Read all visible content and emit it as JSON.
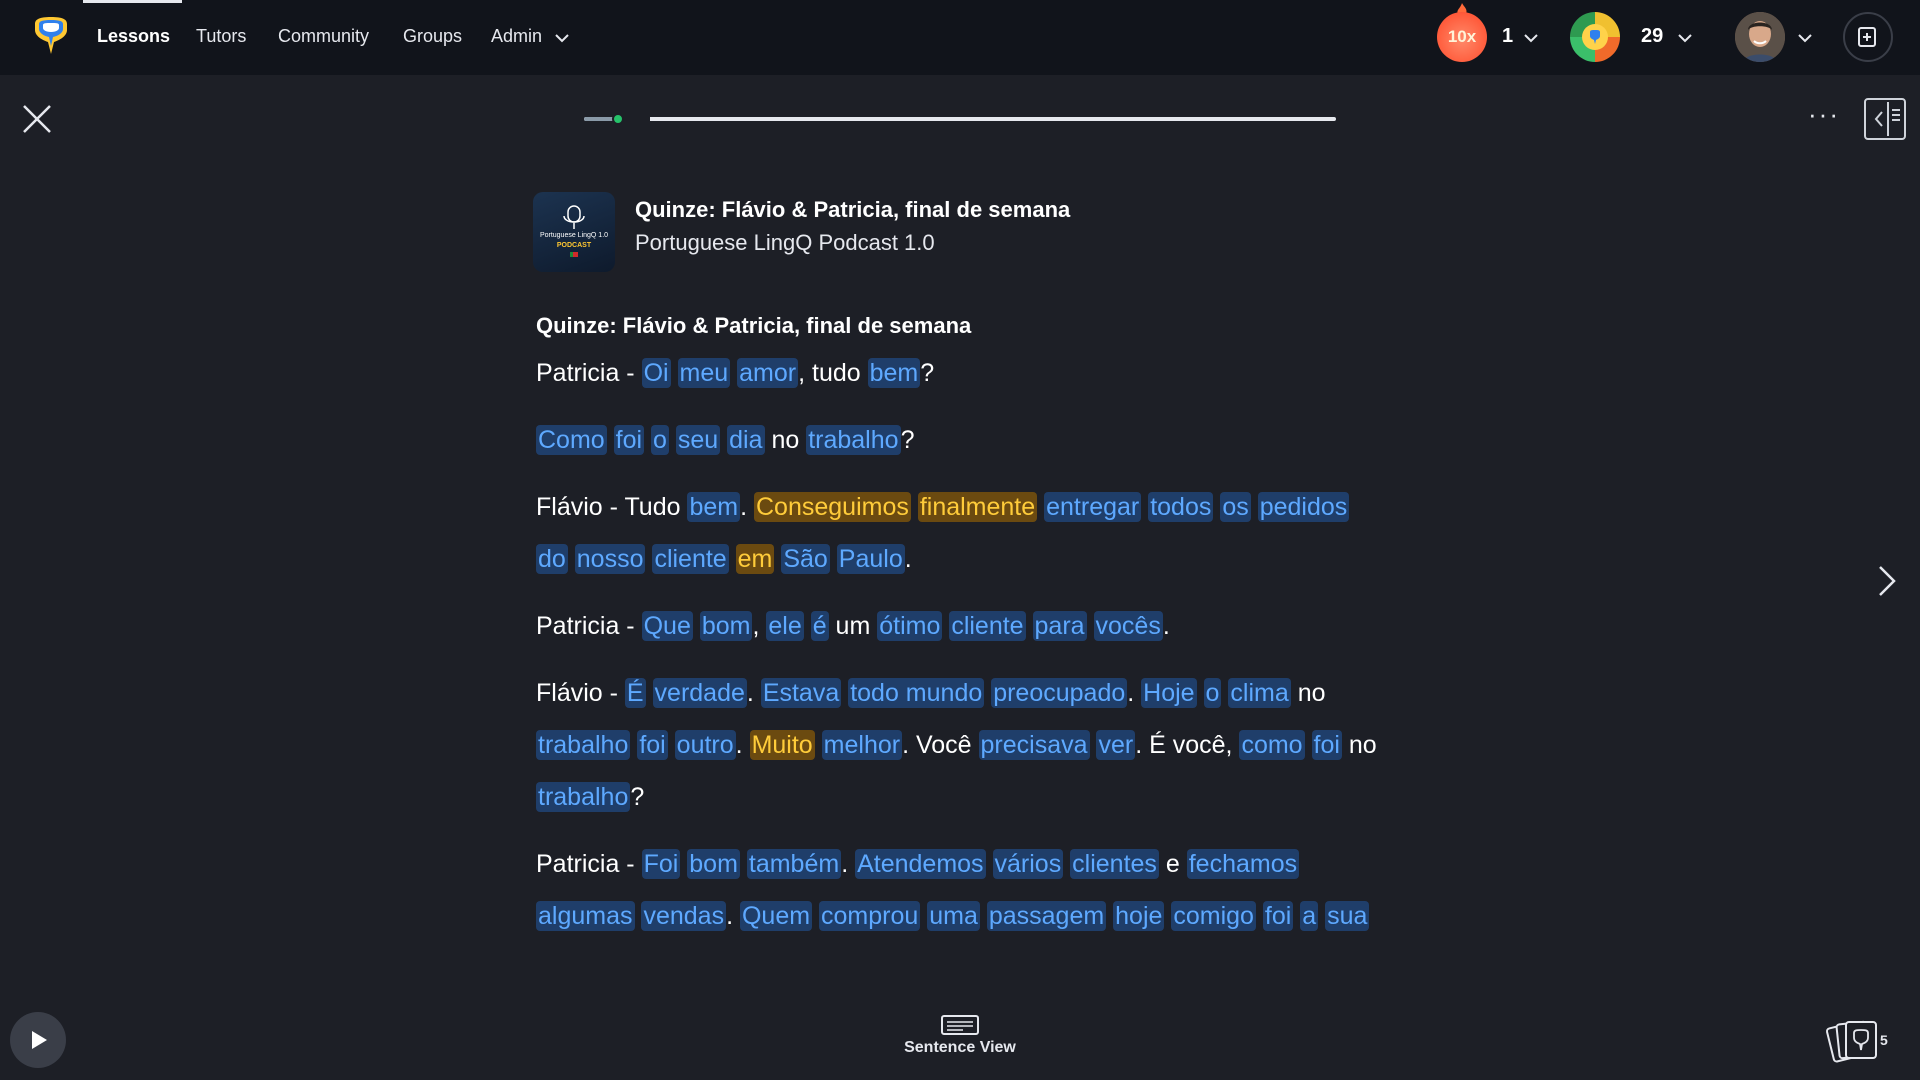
{
  "nav": {
    "items": [
      {
        "label": "Lessons"
      },
      {
        "label": "Tutors"
      },
      {
        "label": "Community"
      },
      {
        "label": "Groups"
      },
      {
        "label": "Admin"
      }
    ],
    "streak_multiplier": "10x",
    "streak_count": "1",
    "coins_count": "29",
    "icons": [
      "logo-icon",
      "chevron-down-icon",
      "flame-icon",
      "coin-icon",
      "avatar",
      "create-lesson-icon"
    ]
  },
  "toolbar": {
    "progress": 0.04,
    "more_label": "···"
  },
  "lesson": {
    "title": "Quinze: Flávio & Patricia, final de semana",
    "course": "Portuguese LingQ Podcast 1.0",
    "thumb_line1": "Portuguese LingQ 1.0",
    "thumb_line2": "PODCAST"
  },
  "reader": {
    "heading": "Quinze: Flávio & Patricia, final de semana",
    "paragraphs": [
      [
        [
          "Patricia - ",
          "p"
        ],
        [
          "Oi",
          "b"
        ],
        [
          " ",
          "p"
        ],
        [
          "meu",
          "b"
        ],
        [
          " ",
          "p"
        ],
        [
          "amor",
          "b"
        ],
        [
          ", tudo ",
          "p"
        ],
        [
          "bem",
          "b"
        ],
        [
          "?",
          "p"
        ]
      ],
      [
        [
          "Como",
          "b"
        ],
        [
          " ",
          "p"
        ],
        [
          "foi",
          "b"
        ],
        [
          " ",
          "p"
        ],
        [
          "o",
          "b"
        ],
        [
          " ",
          "p"
        ],
        [
          "seu",
          "b"
        ],
        [
          " ",
          "p"
        ],
        [
          "dia",
          "b"
        ],
        [
          " no ",
          "p"
        ],
        [
          "trabalho",
          "b"
        ],
        [
          "?",
          "p"
        ]
      ],
      [
        [
          "Flávio - Tudo ",
          "p"
        ],
        [
          "bem",
          "b"
        ],
        [
          ". ",
          "p"
        ],
        [
          "Conseguimos",
          "y"
        ],
        [
          " ",
          "p"
        ],
        [
          "finalmente",
          "y"
        ],
        [
          " ",
          "p"
        ],
        [
          "entregar",
          "b"
        ],
        [
          " ",
          "p"
        ],
        [
          "todos",
          "b"
        ],
        [
          " ",
          "p"
        ],
        [
          "os",
          "b"
        ],
        [
          " ",
          "p"
        ],
        [
          "pedidos",
          "b"
        ],
        [
          " ",
          "p"
        ],
        [
          "do",
          "b"
        ],
        [
          " ",
          "p"
        ],
        [
          "nosso",
          "b"
        ],
        [
          " ",
          "p"
        ],
        [
          "cliente",
          "b"
        ],
        [
          " ",
          "p"
        ],
        [
          "em",
          "y"
        ],
        [
          " ",
          "p"
        ],
        [
          "São",
          "b"
        ],
        [
          " ",
          "p"
        ],
        [
          "Paulo",
          "b"
        ],
        [
          ".",
          "p"
        ]
      ],
      [
        [
          "Patricia - ",
          "p"
        ],
        [
          "Que",
          "b"
        ],
        [
          " ",
          "p"
        ],
        [
          "bom",
          "b"
        ],
        [
          ", ",
          "p"
        ],
        [
          "ele",
          "b"
        ],
        [
          " ",
          "p"
        ],
        [
          "é",
          "b"
        ],
        [
          " um ",
          "p"
        ],
        [
          "ótimo",
          "b"
        ],
        [
          " ",
          "p"
        ],
        [
          "cliente",
          "b"
        ],
        [
          " ",
          "p"
        ],
        [
          "para",
          "b"
        ],
        [
          " ",
          "p"
        ],
        [
          "vocês",
          "b"
        ],
        [
          ".",
          "p"
        ]
      ],
      [
        [
          "Flávio - ",
          "p"
        ],
        [
          "É",
          "b"
        ],
        [
          " ",
          "p"
        ],
        [
          "verdade",
          "b"
        ],
        [
          ". ",
          "p"
        ],
        [
          "Estava",
          "b"
        ],
        [
          " ",
          "p"
        ],
        [
          "todo mundo",
          "b"
        ],
        [
          " ",
          "p"
        ],
        [
          "preocupado",
          "b"
        ],
        [
          ". ",
          "p"
        ],
        [
          "Hoje",
          "b"
        ],
        [
          " ",
          "p"
        ],
        [
          "o",
          "b"
        ],
        [
          " ",
          "p"
        ],
        [
          "clima",
          "b"
        ],
        [
          " no ",
          "p"
        ],
        [
          "trabalho",
          "b"
        ],
        [
          " ",
          "p"
        ],
        [
          "foi",
          "b"
        ],
        [
          " ",
          "p"
        ],
        [
          "outro",
          "b"
        ],
        [
          ". ",
          "p"
        ],
        [
          "Muito",
          "y"
        ],
        [
          " ",
          "p"
        ],
        [
          "melhor",
          "b"
        ],
        [
          ". Você ",
          "p"
        ],
        [
          "precisava",
          "b"
        ],
        [
          " ",
          "p"
        ],
        [
          "ver",
          "b"
        ],
        [
          ". É você, ",
          "p"
        ],
        [
          "como",
          "b"
        ],
        [
          " ",
          "p"
        ],
        [
          "foi",
          "b"
        ],
        [
          " no ",
          "p"
        ],
        [
          "trabalho",
          "b"
        ],
        [
          "?",
          "p"
        ]
      ],
      [
        [
          "Patricia - ",
          "p"
        ],
        [
          "Foi",
          "b"
        ],
        [
          " ",
          "p"
        ],
        [
          "bom",
          "b"
        ],
        [
          " ",
          "p"
        ],
        [
          "também",
          "b"
        ],
        [
          ". ",
          "p"
        ],
        [
          "Atendemos",
          "b"
        ],
        [
          " ",
          "p"
        ],
        [
          "vários",
          "b"
        ],
        [
          " ",
          "p"
        ],
        [
          "clientes",
          "b"
        ],
        [
          " e ",
          "p"
        ],
        [
          "fechamos",
          "b"
        ],
        [
          " ",
          "p"
        ],
        [
          "algumas",
          "b"
        ],
        [
          " ",
          "p"
        ],
        [
          "vendas",
          "b"
        ],
        [
          ". ",
          "p"
        ],
        [
          "Quem",
          "b"
        ],
        [
          " ",
          "p"
        ],
        [
          "comprou",
          "b"
        ],
        [
          " ",
          "p"
        ],
        [
          "uma",
          "b"
        ],
        [
          " ",
          "p"
        ],
        [
          "passagem",
          "b"
        ],
        [
          " ",
          "p"
        ],
        [
          "hoje",
          "b"
        ],
        [
          " ",
          "p"
        ],
        [
          "comigo",
          "b"
        ],
        [
          " ",
          "p"
        ],
        [
          "foi",
          "b"
        ],
        [
          " ",
          "p"
        ],
        [
          "a",
          "b"
        ],
        [
          " ",
          "p"
        ],
        [
          "sua",
          "b"
        ]
      ]
    ]
  },
  "bottom": {
    "sentence_view_label": "Sentence View",
    "cards_count": "5"
  },
  "colors": {
    "background": "#1d1f26",
    "navbar": "#11141b",
    "known_word_bg": "#1f3e6a",
    "known_word_text": "#5ea9ff",
    "lingq_word_bg": "#6b4a10",
    "lingq_word_text": "#ffcc3a",
    "progress_dot": "#26c26a"
  }
}
